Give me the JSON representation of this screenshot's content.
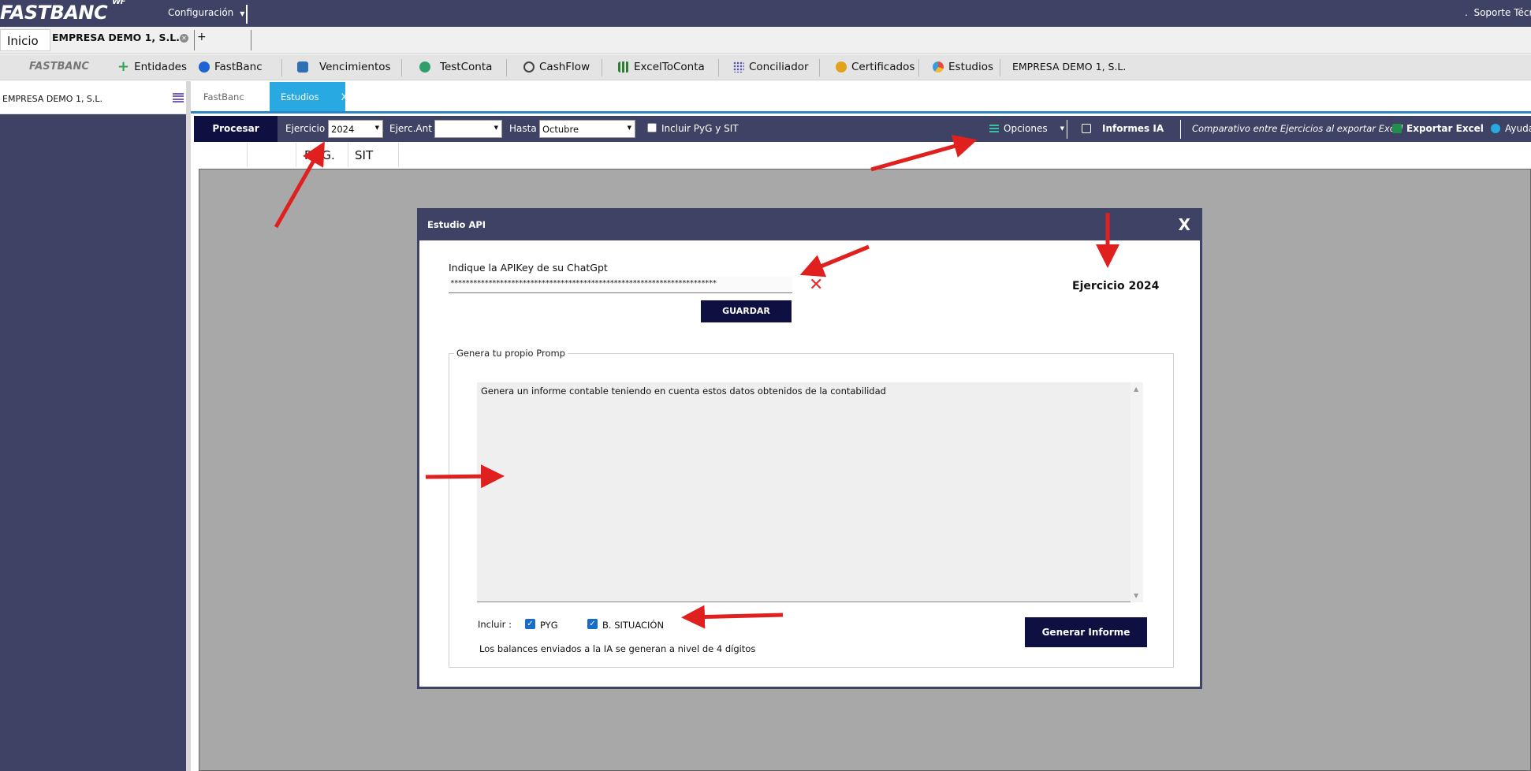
{
  "appbar": {
    "logo": "FASTBANC",
    "logo_sup": "WF",
    "config_menu": "Configuración",
    "support": "Soporte Técn"
  },
  "doc_tabs": {
    "home": "Inicio",
    "company": "EMPRESA DEMO 1, S.L.",
    "add": "+"
  },
  "modules": {
    "brand": "FASTBANC",
    "items": [
      {
        "label": "Entidades",
        "icon": "plus-icon"
      },
      {
        "label": "FastBanc",
        "icon": "apple-icon"
      },
      {
        "label": "Vencimientos",
        "icon": "calendar-icon"
      },
      {
        "label": "TestConta",
        "icon": "check-globe-icon"
      },
      {
        "label": "CashFlow",
        "icon": "coin-icon"
      },
      {
        "label": "ExcelToConta",
        "icon": "columns-icon"
      },
      {
        "label": "Conciliador",
        "icon": "grid-icon"
      },
      {
        "label": "Certificados",
        "icon": "certificate-icon"
      },
      {
        "label": "Estudios",
        "icon": "pie-icon"
      }
    ],
    "company": "EMPRESA DEMO 1, S.L."
  },
  "sidebar": {
    "company": "EMPRESA DEMO 1, S.L."
  },
  "inner_tabs": {
    "fastbanc": "FastBanc",
    "estudios": "Estudios",
    "close": "X"
  },
  "actionbar": {
    "procesar": "Procesar",
    "ejercicio_label": "Ejercicio",
    "ejercicio_value": "2024",
    "ejerc_ant_label": "Ejerc.Ant",
    "ejerc_ant_value": "",
    "hasta_label": "Hasta",
    "hasta_value": "Octubre",
    "incluir_label": "Incluir PyG y SIT",
    "opciones": "Opciones",
    "informes_ia": "Informes IA",
    "comparativo": "Comparativo entre Ejercicios al exportar Excel",
    "exportar": "Exportar Excel",
    "ayuda": "Ayuda"
  },
  "columns": {
    "pyg": "P.Y.G.",
    "sit": "SIT"
  },
  "dialog": {
    "title": "Estudio API",
    "close": "X",
    "api_label": "Indique la APIKey de su ChatGpt",
    "api_value": "**********************************************************************",
    "clear": "✕",
    "guardar": "GUARDAR",
    "ejercicio": "Ejercicio 2024",
    "prompt_legend": "Genera tu propio Promp",
    "prompt_text": "Genera un informe contable teniendo en cuenta estos datos obtenidos de la contabilidad",
    "incluir_label": "Incluir :",
    "pyg_label": "PYG",
    "pyg_checked": true,
    "bsit_label": "B. SITUACIÓN",
    "bsit_checked": true,
    "nota": "Los balances enviados a la IA se generan a nivel de 4 dígitos",
    "generar": "Generar Informe"
  },
  "colors": {
    "navy": "#3e4366",
    "dark_button": "#0d1040",
    "accent_tab": "#29a9e1",
    "arrow_red": "#e0201e",
    "checkbox_blue": "#1a6bc7"
  }
}
